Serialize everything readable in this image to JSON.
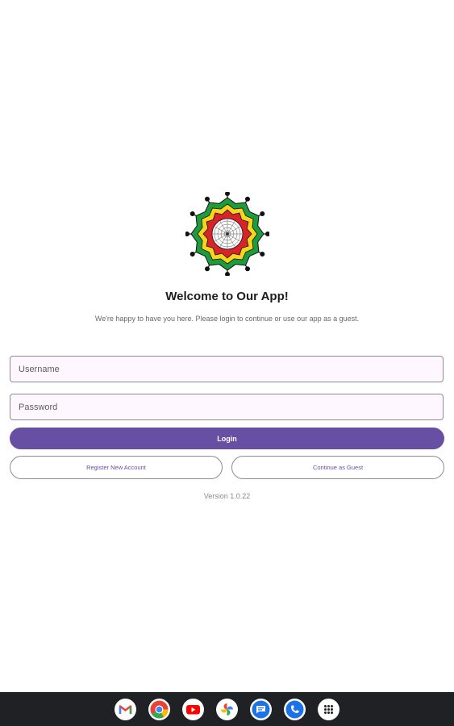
{
  "welcome": {
    "title": "Welcome to Our App!",
    "subtitle": "We're happy to have you here. Please login to continue or use our app as a guest."
  },
  "form": {
    "username_placeholder": "Username",
    "password_placeholder": "Password",
    "login_label": "Login",
    "register_label": "Register New Account",
    "guest_label": "Continue as Guest"
  },
  "version": "Version 1.0.22",
  "colors": {
    "primary": "#6750a4",
    "field_background": "#fef7ff",
    "taskbar": "#202124"
  },
  "taskbar": {
    "apps": [
      {
        "name": "gmail-icon"
      },
      {
        "name": "chrome-icon"
      },
      {
        "name": "youtube-icon"
      },
      {
        "name": "photos-icon"
      },
      {
        "name": "messages-icon"
      },
      {
        "name": "phone-icon"
      },
      {
        "name": "app-launcher-icon"
      }
    ]
  }
}
